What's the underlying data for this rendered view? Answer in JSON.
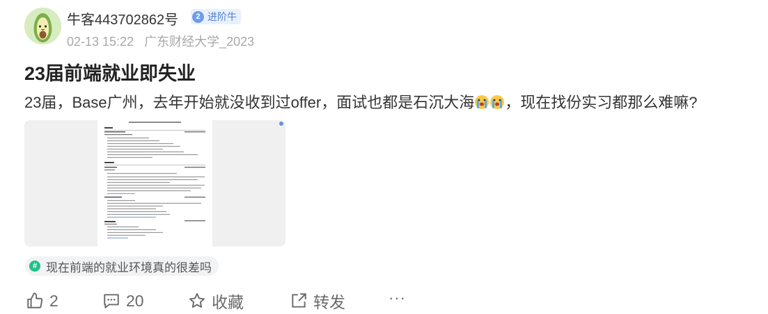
{
  "user": {
    "name": "牛客443702862号",
    "level": "2",
    "level_label": "进阶牛",
    "date": "02-13 15:22",
    "school": "广东财经大学_2023"
  },
  "post": {
    "title": "23届前端就业即失业",
    "content_before": "23届，Base广州，去年开始就没收到过offer，面试也都是石沉大海",
    "content_after": "，现在找份实习都那么难嘛?"
  },
  "topic": {
    "label": "现在前端的就业环境真的很差吗",
    "icon": "hash-icon"
  },
  "actions": {
    "like_count": "2",
    "comment_count": "20",
    "collect_label": "收藏",
    "share_label": "转发",
    "more_label": "···"
  },
  "colors": {
    "level_badge_bg": "#e8f0fd",
    "level_accent": "#4e7fd6",
    "topic_icon": "#21c18a",
    "meta_text": "#a9a9a9",
    "action_text": "#6b6b6b"
  }
}
